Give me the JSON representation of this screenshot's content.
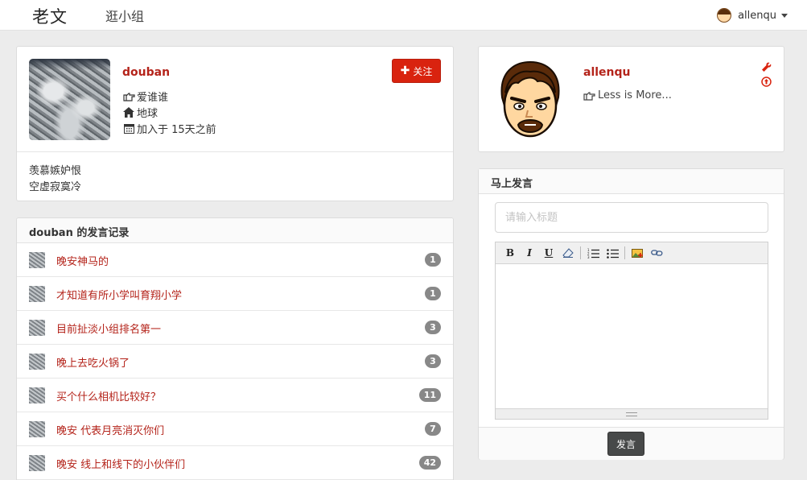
{
  "nav": {
    "brand": "老文",
    "browse_groups": "逛小组",
    "username": "allenqu"
  },
  "profile": {
    "name": "douban",
    "follow_label": "关注",
    "following_who": "爱谁谁",
    "location": "地球",
    "joined": "加入于 15天之前",
    "bio_lines": [
      "羡慕嫉妒恨",
      "空虚寂寞冷"
    ]
  },
  "posts": {
    "heading": "douban 的发言记录",
    "items": [
      {
        "title": "晚安神马的",
        "count": "1"
      },
      {
        "title": "才知道有所小学叫育翔小学",
        "count": "1"
      },
      {
        "title": "目前扯淡小组排名第一",
        "count": "3"
      },
      {
        "title": "晚上去吃火锅了",
        "count": "3"
      },
      {
        "title": "买个什么相机比较好？",
        "count": "11"
      },
      {
        "title": "晚安 代表月亮消灭你们",
        "count": "7"
      },
      {
        "title": "晚安 线上和线下的小伙伴们",
        "count": "42"
      }
    ]
  },
  "user_card": {
    "name": "allenqu",
    "motto": "Less is More..."
  },
  "post_form": {
    "heading": "马上发言",
    "title_placeholder": "请输入标题",
    "submit_label": "发言"
  },
  "icons": {
    "thumbs": "hand-pointing-right-icon",
    "home": "home-icon",
    "calendar": "calendar-icon",
    "wrench": "wrench-icon",
    "upload": "upload-circle-icon"
  },
  "colors": {
    "accent": "#b4231a",
    "button_red": "#d9230f",
    "badge_gray": "#888888",
    "submit_dark": "#474949"
  }
}
